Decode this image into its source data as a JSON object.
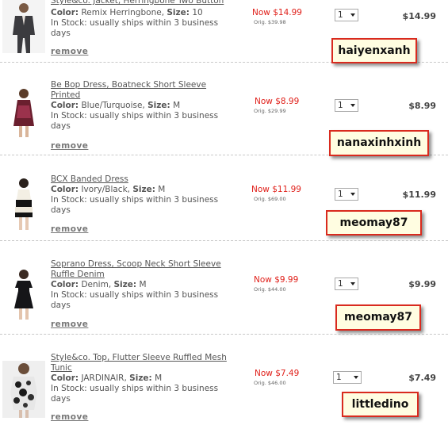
{
  "labels": {
    "color": "Color:",
    "size": "Size:",
    "remove": "remove"
  },
  "items": [
    {
      "title": "Style&co. Jacket, Herringbone Two Button",
      "color": "Remix Herringbone",
      "size": "10",
      "stock": "In Stock: usually ships within 3 business days",
      "now_price": "Now $14.99",
      "orig_price": "Orig. $39.98",
      "qty": "1",
      "total": "$14.99",
      "tag": "haiyenxanh"
    },
    {
      "title": "Be Bop Dress, Boatneck Short Sleeve Printed",
      "color": "Blue/Turquoise",
      "size": "M",
      "stock": "In Stock: usually ships within 3 business days",
      "now_price": "Now $8.99",
      "orig_price": "Orig. $29.99",
      "qty": "1",
      "total": "$8.99",
      "tag": "nanaxinhxinh"
    },
    {
      "title": "BCX Banded Dress",
      "color": "Ivory/Black",
      "size": "M",
      "stock": "In Stock: usually ships within 3 business days",
      "now_price": "Now $11.99",
      "orig_price": "Orig. $69.00",
      "qty": "1",
      "total": "$11.99",
      "tag": "meomay87"
    },
    {
      "title": "Soprano Dress, Scoop Neck Short Sleeve Ruffle Denim",
      "color": "Denim",
      "size": "M",
      "stock": "In Stock: usually ships within 3 business days",
      "now_price": "Now $9.99",
      "orig_price": "Orig. $44.00",
      "qty": "1",
      "total": "$9.99",
      "tag": "meomay87"
    },
    {
      "title": "Style&co. Top, Flutter Sleeve Ruffled Mesh Tunic",
      "color": "JARDINAIR",
      "size": "M",
      "stock": "In Stock: usually ships within 3 business days",
      "now_price": "Now $7.49",
      "orig_price": "Orig. $46.00",
      "qty": "1",
      "total": "$7.49",
      "tag": "littledino"
    }
  ]
}
